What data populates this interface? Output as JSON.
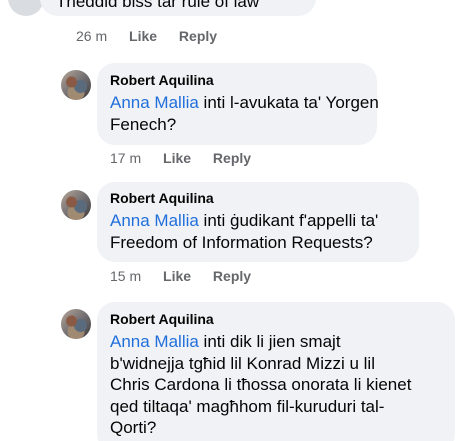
{
  "top_comment": {
    "text": "Theddid  biss tar rule of law",
    "time": "26 m",
    "like_label": "Like",
    "reply_label": "Reply"
  },
  "replies": [
    {
      "author": "Robert Aquilina",
      "mention": "Anna Mallia",
      "line1": " inti l-avukata ta' Yorgen",
      "lines": [
        "Fenech?"
      ],
      "time": "17 m",
      "like_label": "Like",
      "reply_label": "Reply"
    },
    {
      "author": "Robert Aquilina",
      "mention": "Anna Mallia",
      "line1": " inti ġudikant f'appelli ta'",
      "lines": [
        "Freedom of Information Requests?"
      ],
      "time": "15 m",
      "like_label": "Like",
      "reply_label": "Reply"
    },
    {
      "author": "Robert Aquilina",
      "mention": "Anna Mallia",
      "line1": " inti dik li jien smajt",
      "lines": [
        "b'widnejja tgħid lil Konrad Mizzi u lil",
        "Chris Cardona li tħossa onorata li kienet",
        "qed tiltaqa' magħhom fil-kuruduri tal-",
        "Qorti?"
      ]
    }
  ]
}
